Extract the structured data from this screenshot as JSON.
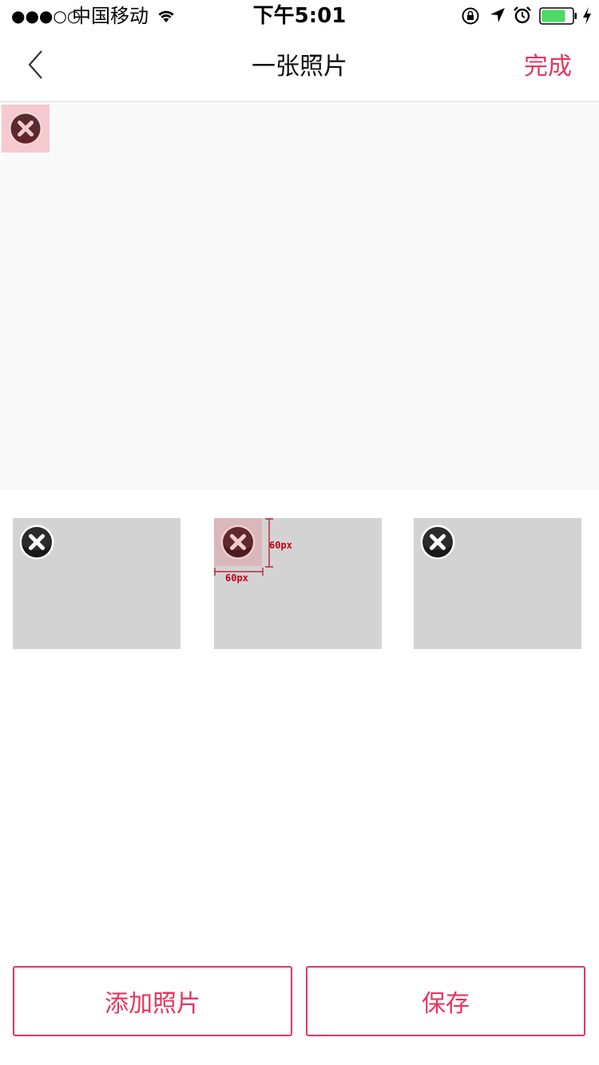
{
  "status_bar": {
    "signal": "●●●○○",
    "carrier": "中国移动",
    "time": "下午5:01",
    "battery_color": "#4cd964"
  },
  "nav": {
    "title": "一张照片",
    "done_label": "完成"
  },
  "thumbnails": {
    "dim_width_label": "60px",
    "dim_height_label": "60px"
  },
  "buttons": {
    "add_label": "添加照片",
    "save_label": "保存"
  },
  "colors": {
    "accent": "#e8345e",
    "thumb_bg": "#d3d3d3",
    "preview_bg": "#f9f9f9"
  }
}
